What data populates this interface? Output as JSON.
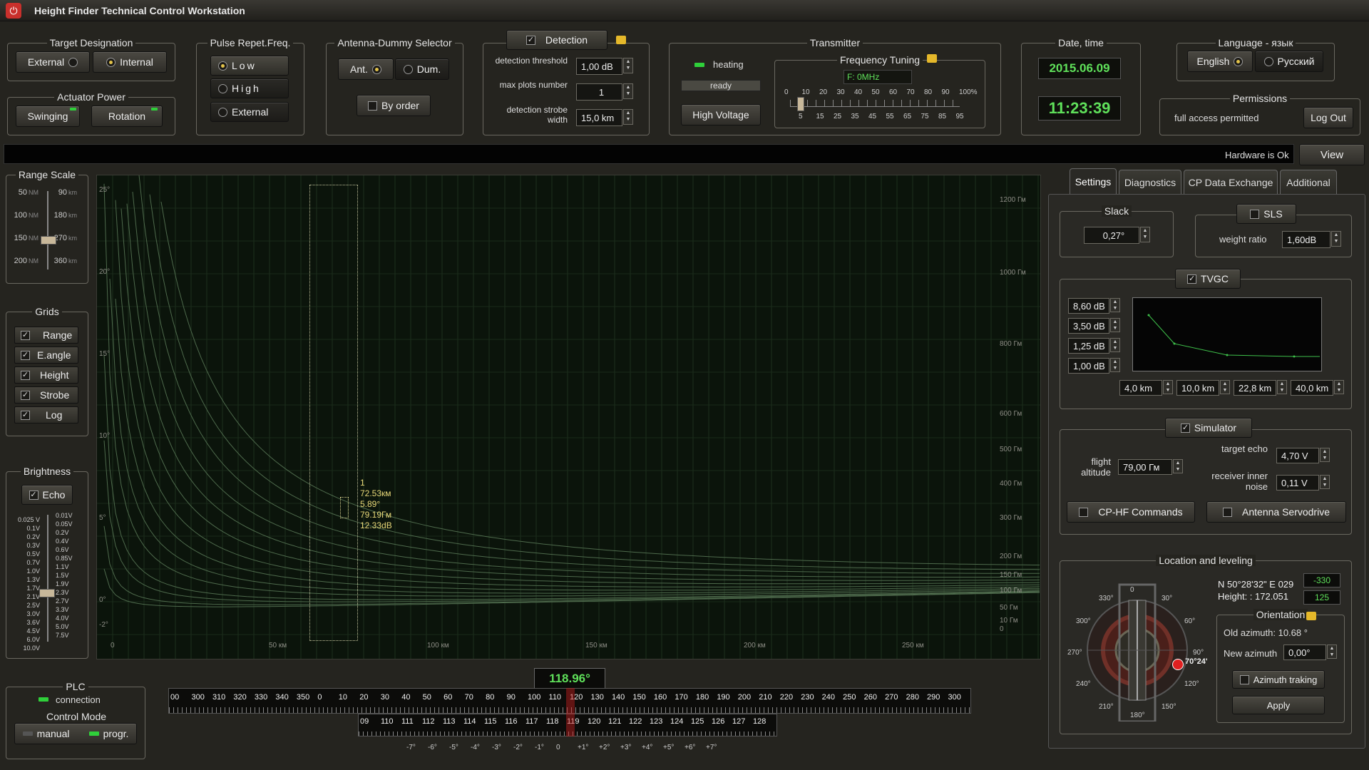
{
  "app": {
    "title": "Height Finder Technical Control Workstation"
  },
  "target_designation": {
    "title": "Target Designation",
    "external": "External",
    "internal": "Internal"
  },
  "actuator_power": {
    "title": "Actuator Power",
    "swinging": "Swinging",
    "rotation": "Rotation"
  },
  "prf": {
    "title": "Pulse Repet.Freq.",
    "low": "Low",
    "high": "High",
    "external": "External"
  },
  "antenna_dummy": {
    "title": "Antenna-Dummy Selector",
    "ant": "Ant.",
    "dum": "Dum.",
    "by_order": "By order"
  },
  "detection": {
    "title": "Detection",
    "threshold_label": "detection threshold",
    "threshold_value": "1,00 dB",
    "max_plots_label": "max plots number",
    "max_plots_value": "1",
    "strobe_label": "detection strobe width",
    "strobe_value": "15,0 km"
  },
  "transmitter": {
    "title": "Transmitter",
    "heating": "heating",
    "ready": "ready",
    "high_voltage": "High Voltage",
    "freq_title": "Frequency Tuning",
    "freq_value": "F: 0MHz",
    "scale_top": [
      "0",
      "10",
      "20",
      "30",
      "40",
      "50",
      "60",
      "70",
      "80",
      "90",
      "100%"
    ],
    "scale_bottom": [
      "5",
      "15",
      "25",
      "35",
      "45",
      "55",
      "65",
      "75",
      "85",
      "95"
    ]
  },
  "datetime": {
    "title": "Date, time",
    "date": "2015.06.09",
    "time": "11:23:39"
  },
  "language": {
    "title": "Language - язык",
    "english": "English",
    "russian": "Русский"
  },
  "permissions": {
    "title": "Permissions",
    "status": "full access permitted",
    "logout": "Log Out"
  },
  "statusbar": {
    "message": "Hardware is Ok",
    "view": "View"
  },
  "range_scale": {
    "title": "Range Scale",
    "nm": [
      "50",
      "100",
      "150",
      "200"
    ],
    "nm_unit": "NM",
    "km": [
      "90",
      "180",
      "270",
      "360"
    ],
    "km_unit": "km"
  },
  "grids": {
    "title": "Grids",
    "items": [
      "Range",
      "E.angle",
      "Height",
      "Strobe",
      "Log"
    ]
  },
  "brightness": {
    "title": "Brightness",
    "echo": "Echo",
    "left": [
      "0.025 V",
      "0.1V",
      "0.2V",
      "0.3V",
      "0.5V",
      "0.7V",
      "1.0V",
      "1.3V",
      "1.7V",
      "2.1V",
      "2.5V",
      "3.0V",
      "3.6V",
      "4.5V",
      "6.0V",
      "10.0V"
    ],
    "right": [
      "0.01V",
      "0.05V",
      "0.2V",
      "0.4V",
      "0.6V",
      "0.85V",
      "1.1V",
      "1.5V",
      "1.9V",
      "2.3V",
      "2.7V",
      "3.3V",
      "4.0V",
      "5.0V",
      "7.5V"
    ]
  },
  "plot": {
    "y_ticks": [
      "25°",
      "20°",
      "15°",
      "10°",
      "5°",
      "0°",
      "-2°"
    ],
    "x_ticks": [
      "0",
      "50 км",
      "100 км",
      "150 км",
      "200 км",
      "250 км"
    ],
    "h_ticks": [
      "1200 Гм",
      "1000 Гм",
      "800 Гм",
      "600 Гм",
      "500 Гм",
      "400 Гм",
      "300 Гм",
      "200 Гм",
      "150 Гм",
      "100 Гм",
      "50 Гм",
      "10 Гм",
      "0"
    ],
    "target": [
      "1",
      "72.53км",
      "5.89°",
      "79.19Гм",
      "12.33dB"
    ]
  },
  "plc": {
    "title": "PLC",
    "connection": "connection",
    "mode_title": "Control Mode",
    "manual": "manual",
    "progr": "progr."
  },
  "azimuth": {
    "value": "118.96°",
    "coarse": [
      "00",
      "300",
      "310",
      "320",
      "330",
      "340",
      "350",
      "0",
      "10",
      "20",
      "30",
      "40",
      "50",
      "60",
      "70",
      "80",
      "90",
      "100",
      "110",
      "120",
      "130",
      "140",
      "150",
      "160",
      "170",
      "180",
      "190",
      "200",
      "210",
      "220",
      "230",
      "240",
      "250",
      "260",
      "270",
      "280",
      "290",
      "300"
    ],
    "fine": [
      "09",
      "110",
      "111",
      "112",
      "113",
      "114",
      "115",
      "116",
      "117",
      "118",
      "119",
      "120",
      "121",
      "122",
      "123",
      "124",
      "125",
      "126",
      "127",
      "128"
    ],
    "deg": [
      "-7°",
      "-6°",
      "-5°",
      "-4°",
      "-3°",
      "-2°",
      "-1°",
      "0",
      "+1°",
      "+2°",
      "+3°",
      "+4°",
      "+5°",
      "+6°",
      "+7°"
    ]
  },
  "tabs": [
    "Settings",
    "Diagnostics",
    "CP Data Exchange",
    "Additional"
  ],
  "settings": {
    "slack_title": "Slack",
    "slack_value": "0,27°",
    "sls": "SLS",
    "weight_ratio_label": "weight ratio",
    "weight_ratio_value": "1,60dB",
    "tvgc": "TVGC",
    "tvgc_db": [
      "8,60 dB",
      "3,50 dB",
      "1,25 dB",
      "1,00 dB"
    ],
    "tvgc_km": [
      "4,0 km",
      "10,0 km",
      "22,8 km",
      "40,0 km"
    ],
    "simulator": "Simulator",
    "flight_alt_label": "flight altitude",
    "flight_alt_value": "79,00 Гм",
    "target_echo_label": "target echo",
    "target_echo_value": "4,70 V",
    "noise_label": "receiver inner noise",
    "noise_value": "0,11 V",
    "cp_hf": "CP-HF Commands",
    "servodrive": "Antenna Servodrive"
  },
  "location": {
    "title": "Location and leveling",
    "coords": "N 50°28'32\"  E 029",
    "height": "Height: : 172.051",
    "val1": "-330",
    "val2": "125",
    "orientation_title": "Orientation",
    "old_azimuth": "Old azimuth:  10.68 °",
    "new_azimuth_label": "New azimuth",
    "new_azimuth_value": "0,00°",
    "azimuth_tracking": "Azimuth traking",
    "apply": "Apply",
    "compass_labels": [
      "0",
      "30°",
      "60°",
      "90°",
      "120°",
      "150°",
      "180°",
      "210°",
      "240°",
      "270°",
      "300°",
      "330°"
    ],
    "pointer": "70°24'"
  },
  "colors": {
    "accent_green": "#5fe05a",
    "plot_bg": "#0b140b",
    "plot_line": "#5d7a5b",
    "target_yellow": "#e8d878",
    "led_red": "#e02020"
  }
}
